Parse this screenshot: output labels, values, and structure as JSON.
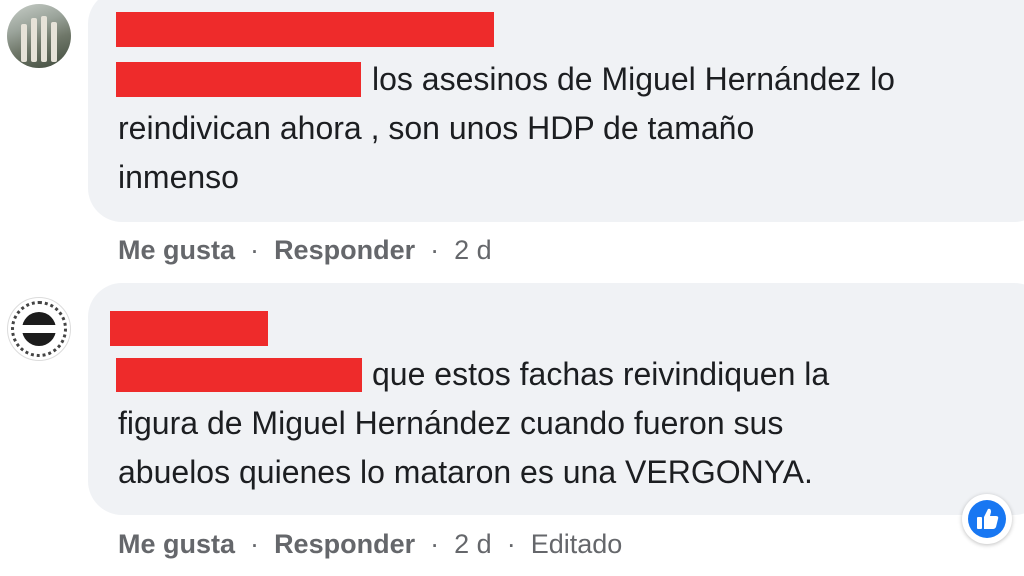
{
  "colors": {
    "bubble_background": "#f0f2f5",
    "text": "#1c1e21",
    "secondary_text": "#65676b",
    "redaction": "#ee2b2b",
    "like_blue": "#1877f2"
  },
  "comments": [
    {
      "author_redacted": true,
      "avatar_icon": "building-photo-avatar",
      "lines": [
        "los asesinos de Miguel Hernández lo",
        "reindivican ahora , son unos HDP de tamaño",
        "inmenso"
      ],
      "actions": {
        "like": "Me gusta",
        "reply": "Responder",
        "time": "2 d",
        "separator": "·"
      }
    },
    {
      "author_redacted": true,
      "avatar_icon": "circular-logo-avatar",
      "lines": [
        "que estos fachas reivindiquen la",
        "figura de Miguel Hernández cuando fueron sus",
        "abuelos quienes lo mataron es una VERGONYA."
      ],
      "actions": {
        "like": "Me gusta",
        "reply": "Responder",
        "time": "2 d",
        "edited": "Editado",
        "separator": "·"
      },
      "reaction_icon": "like-thumb-icon"
    }
  ]
}
